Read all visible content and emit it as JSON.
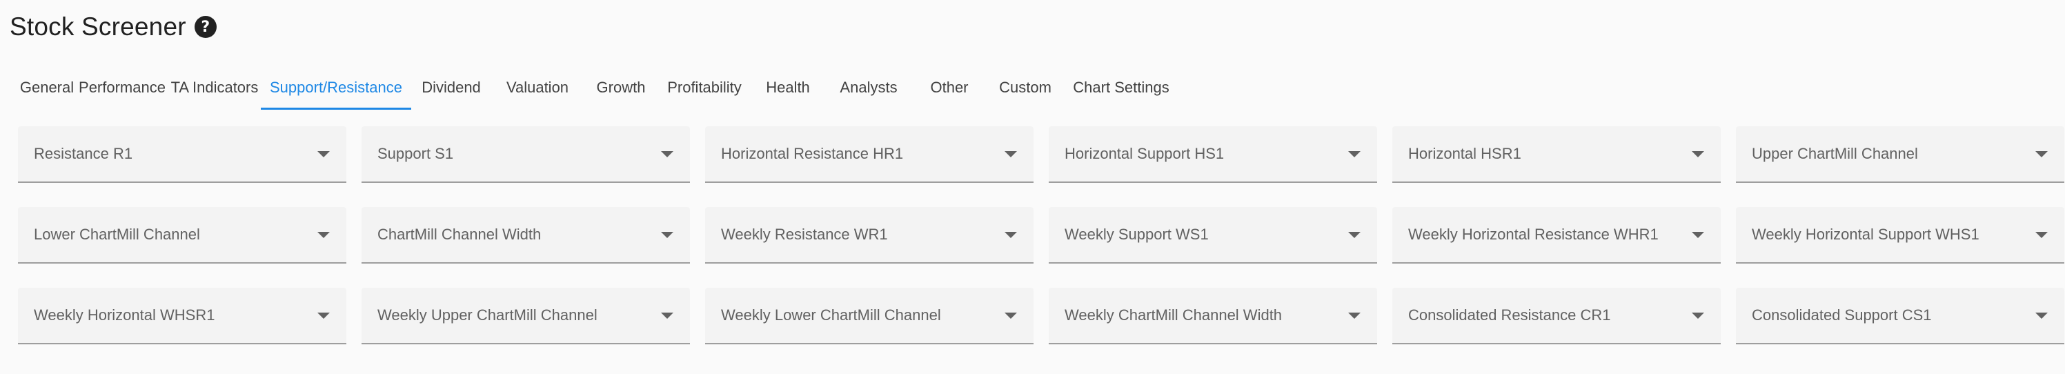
{
  "header": {
    "title": "Stock Screener",
    "help_glyph": "?"
  },
  "tabs": [
    {
      "label": "General",
      "active": false
    },
    {
      "label": "Performance",
      "active": false
    },
    {
      "label": "TA Indicators",
      "active": false
    },
    {
      "label": "Support/Resistance",
      "active": true
    },
    {
      "label": "Dividend",
      "active": false
    },
    {
      "label": "Valuation",
      "active": false
    },
    {
      "label": "Growth",
      "active": false
    },
    {
      "label": "Profitability",
      "active": false
    },
    {
      "label": "Health",
      "active": false
    },
    {
      "label": "Analysts",
      "active": false
    },
    {
      "label": "Other",
      "active": false
    },
    {
      "label": "Custom",
      "active": false
    },
    {
      "label": "Chart Settings",
      "active": false
    }
  ],
  "filters": [
    "Resistance R1",
    "Support S1",
    "Horizontal Resistance HR1",
    "Horizontal Support HS1",
    "Horizontal HSR1",
    "Upper ChartMill Channel",
    "Lower ChartMill Channel",
    "ChartMill Channel Width",
    "Weekly Resistance WR1",
    "Weekly Support WS1",
    "Weekly Horizontal Resistance WHR1",
    "Weekly Horizontal Support WHS1",
    "Weekly Horizontal WHSR1",
    "Weekly Upper ChartMill Channel",
    "Weekly Lower ChartMill Channel",
    "Weekly ChartMill Channel Width",
    "Consolidated Resistance CR1",
    "Consolidated Support CS1"
  ],
  "icons": {
    "help": "help-circle-icon",
    "dropdown": "arrow-drop-down-icon"
  },
  "colors": {
    "accent": "#1e88e5",
    "text": "#212121",
    "field_bg": "#f3f3f3",
    "field_border": "#9e9e9e"
  }
}
